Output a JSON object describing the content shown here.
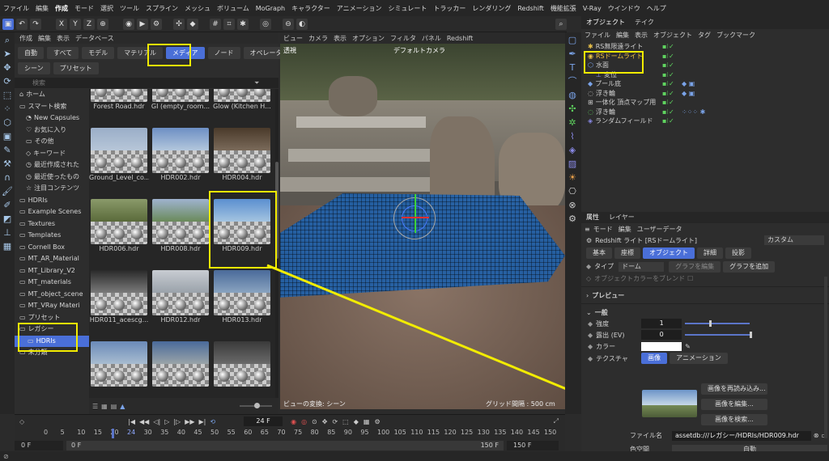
{
  "menubar": [
    "ファイル",
    "編集",
    "作成",
    "モード",
    "選択",
    "ツール",
    "スプライン",
    "メッシュ",
    "ボリューム",
    "MoGraph",
    "キャラクター",
    "アニメーション",
    "シミュレート",
    "トラッカー",
    "レンダリング",
    "Redshift",
    "機能拡張",
    "V-Ray",
    "ウインドウ",
    "ヘルプ"
  ],
  "asset_browser": {
    "menu": [
      "作成",
      "編集",
      "表示",
      "データベース"
    ],
    "categories_row1": [
      "自動",
      "すべて",
      "モデル",
      "マテリアル",
      "メディア",
      "ノード",
      "オペレータ"
    ],
    "categories_row2": [
      "シーン",
      "プリセット"
    ],
    "selected_category": "メディア",
    "search_placeholder": "検索",
    "tree": [
      {
        "label": "ホーム",
        "icon": "home-icon"
      },
      {
        "label": "スマート検索",
        "icon": "folder-icon"
      },
      {
        "label": "New Capsules",
        "icon": "capsule-icon"
      },
      {
        "label": "お気に入り",
        "icon": "heart-icon"
      },
      {
        "label": "その他",
        "icon": "folder-icon"
      },
      {
        "label": "キーワード",
        "icon": "tag-icon"
      },
      {
        "label": "最近作成された",
        "icon": "clock-icon"
      },
      {
        "label": "最近使ったもの",
        "icon": "clock-icon"
      },
      {
        "label": "注目コンテンツ",
        "icon": "star-icon"
      },
      {
        "label": "HDRIs",
        "icon": "folder-icon"
      },
      {
        "label": "Example Scenes",
        "icon": "folder-icon"
      },
      {
        "label": "Textures",
        "icon": "folder-icon"
      },
      {
        "label": "Templates",
        "icon": "folder-icon"
      },
      {
        "label": "Cornell Box",
        "icon": "folder-icon"
      },
      {
        "label": "MT_AR_Material",
        "icon": "folder-icon"
      },
      {
        "label": "MT_Library_V2",
        "icon": "folder-icon"
      },
      {
        "label": "MT_materials",
        "icon": "folder-icon"
      },
      {
        "label": "MT_object_scene",
        "icon": "folder-icon"
      },
      {
        "label": "MT_VRay Materi",
        "icon": "folder-icon"
      },
      {
        "label": "プリセット",
        "icon": "folder-icon"
      },
      {
        "label": "レガシー",
        "icon": "folder-icon"
      },
      {
        "label": "HDRIs",
        "icon": "folder-icon"
      },
      {
        "label": "未分類",
        "icon": "folder-icon"
      }
    ],
    "thumbnails": [
      "Forest Road.hdr",
      "GI (empty_room...",
      "Glow (Kitchen H...",
      "Ground_Level_co...",
      "HDR002.hdr",
      "HDR004.hdr",
      "HDR006.hdr",
      "HDR008.hdr",
      "HDR009.hdr",
      "HDR011_acescg...",
      "HDR012.hdr",
      "HDR013.hdr",
      "",
      "",
      ""
    ]
  },
  "viewport": {
    "menu": [
      "ビュー",
      "カメラ",
      "表示",
      "オプション",
      "フィルタ",
      "パネル",
      "Redshift"
    ],
    "label_left": "透視",
    "camera": "デフォルトカメラ",
    "info_left": "ビューの変換: シーン",
    "grid_info": "グリッド間隔 : 500 cm"
  },
  "timeline": {
    "frame": "24 F",
    "ticks": [
      "0",
      "5",
      "10",
      "15",
      "20",
      "24",
      "30",
      "35",
      "40",
      "45",
      "50",
      "55",
      "60",
      "65",
      "70",
      "75",
      "80",
      "85",
      "90",
      "95",
      "100",
      "105",
      "110",
      "115",
      "120",
      "125",
      "130",
      "135",
      "140",
      "145",
      "150"
    ],
    "start": "0 F",
    "start2": "0 F",
    "end": "150 F",
    "end2": "150 F"
  },
  "object_manager": {
    "tabs": [
      "オブジェクト",
      "テイク"
    ],
    "menu": [
      "ファイル",
      "編集",
      "表示",
      "オブジェクト",
      "タグ",
      "ブックマーク"
    ],
    "objects": [
      {
        "name": "RS無限遠ライト",
        "color": "#cfcfcf"
      },
      {
        "name": "RSドームライト",
        "color": "#f0c040"
      },
      {
        "name": "水面",
        "color": "#cfcfcf"
      },
      {
        "name": "変位",
        "color": "#cfcfcf"
      },
      {
        "name": "プール底",
        "color": "#cfcfcf"
      },
      {
        "name": "浮き輪",
        "color": "#cfcfcf"
      },
      {
        "name": "一体化 頂点マップ用",
        "color": "#cfcfcf"
      },
      {
        "name": "浮き輪",
        "color": "#cfcfcf"
      },
      {
        "name": "ランダムフィールド",
        "color": "#cfcfcf"
      }
    ]
  },
  "attributes": {
    "tabs": [
      "属性",
      "レイヤー"
    ],
    "menu": [
      "モード",
      "編集",
      "ユーザーデータ"
    ],
    "title": "Redshift ライト [RSドームライト]",
    "preset": "カスタム",
    "subtabs": [
      "基本",
      "座標",
      "オブジェクト",
      "詳細",
      "投影"
    ],
    "selected_subtab": "オブジェクト",
    "type_label": "タイプ",
    "type_value": "ドーム",
    "graph_edit": "グラフを編集",
    "graph_add": "グラフを追加",
    "blend_label": "オブジェクトカラーをブレンド",
    "preview_section": "プレビュー",
    "general_section": "一般",
    "intensity_label": "強度",
    "intensity_value": "1",
    "exposure_label": "露出 (EV)",
    "exposure_value": "0",
    "color_label": "カラー",
    "texture_label": "テクスチャ",
    "texture_tabs": [
      "画像",
      "アニメーション"
    ],
    "buttons": [
      "画像を再読み込み...",
      "画像を編集...",
      "画像を検索..."
    ],
    "filename_label": "ファイル名",
    "filename_value": "assetdb:///レガシー/HDRIs/HDR009.hdr",
    "colorspace_label": "色空間",
    "colorspace_value": "自動"
  }
}
